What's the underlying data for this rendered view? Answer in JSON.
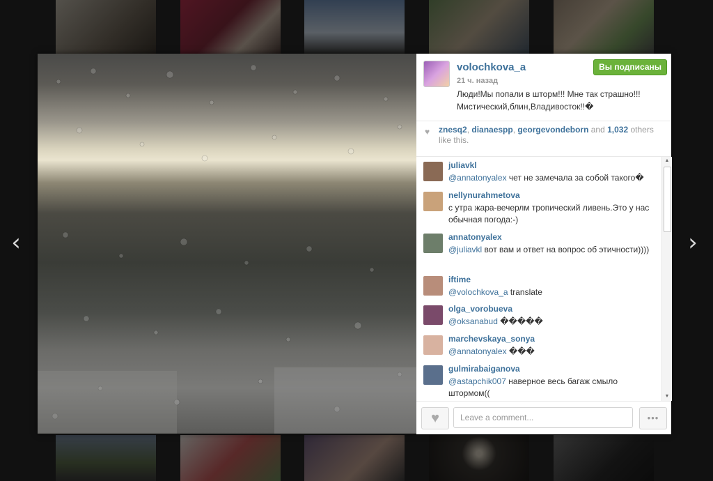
{
  "post": {
    "username": "volochkova_a",
    "time_ago": "21 ч. назад",
    "follow_label": "Вы подписаны",
    "caption_line1": "Люди!Мы попали в шторм!!! Мне так страшно!!!",
    "caption_line2": "Мистический,блин,Владивосток!!�"
  },
  "likes": {
    "user1": "znesq2",
    "user2": "dianaespp",
    "user3": "georgevondeborn",
    "and_text": "and",
    "count": "1,032",
    "suffix": "others like this."
  },
  "comments": [
    {
      "user": "juliavkl",
      "mention": "@annatonyalex",
      "text": " чет не замечала за собой такого�",
      "avatar_color": "#8a6a55"
    },
    {
      "user": "nellynurahmetova",
      "mention": "",
      "text": "с утра жара-вечерлм тропический ливень.Это у нас обычная погода:-)",
      "avatar_color": "#c9a27a"
    },
    {
      "user": "annatonyalex",
      "mention": "@juliavkl",
      "text": " вот вам и ответ на вопрос об этичности))))",
      "avatar_color": "#6d7e6a"
    },
    {
      "user": "iftime",
      "mention": "@volochkova_a",
      "text": " translate",
      "avatar_color": "#b88d7a"
    },
    {
      "user": "olga_vorobueva",
      "mention": "@oksanabud",
      "text": " �����",
      "avatar_color": "#7a4a6a"
    },
    {
      "user": "marchevskaya_sonya",
      "mention": "@annatonyalex",
      "text": " ���",
      "avatar_color": "#d8b2a0"
    },
    {
      "user": "gulmirabaiganova",
      "mention": "@astapchik007",
      "text": " наверное весь багаж смыло штормом((",
      "avatar_color": "#5a6f8c"
    }
  ],
  "footer": {
    "comment_placeholder": "Leave a comment...",
    "more_label": "•••"
  },
  "nav": {
    "prev": "‹",
    "next": "›"
  }
}
